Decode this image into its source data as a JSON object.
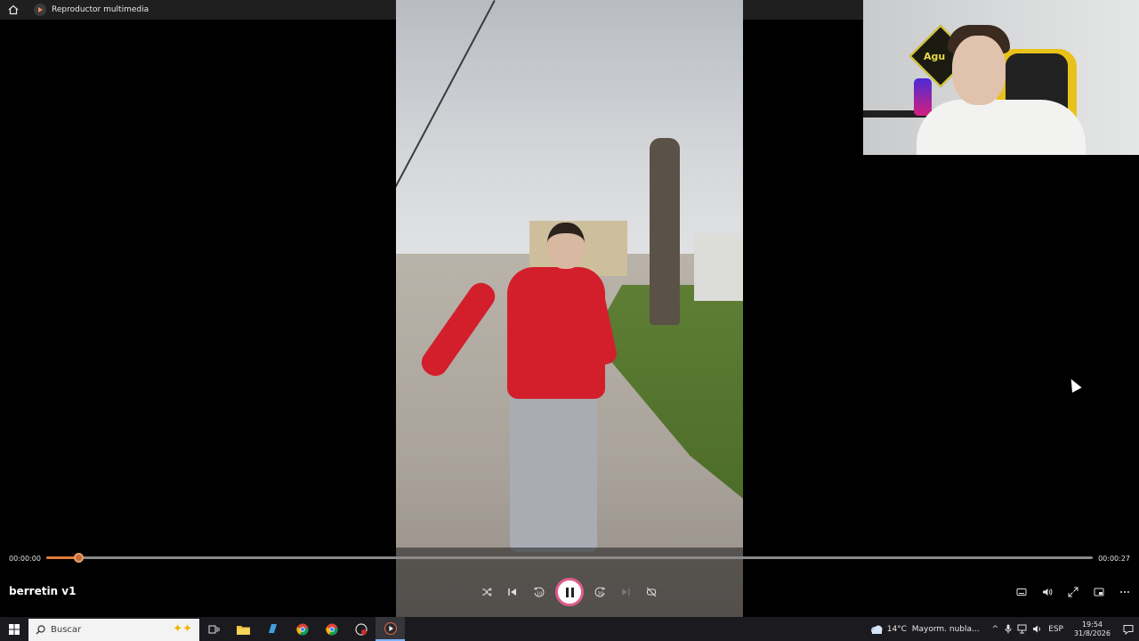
{
  "titlebar": {
    "app_name": "Reproductor multimedia"
  },
  "player": {
    "media_title": "berretin v1",
    "current_time": "00:00:00",
    "total_time": "00:00:27",
    "progress": 0.031
  },
  "webcam": {
    "sign_text": "Agu"
  },
  "taskbar": {
    "search_placeholder": "Buscar",
    "weather_temp": "14°C",
    "weather_desc": "Mayorm. nubla...",
    "language": "ESP",
    "time": "19:54",
    "date": "31/8/2026"
  },
  "colors": {
    "accent": "#e07b3a",
    "play_ring": "#e05c8a",
    "titlebar_bg": "#1f1f1f",
    "taskbar_bg": "#1b1b1f"
  }
}
